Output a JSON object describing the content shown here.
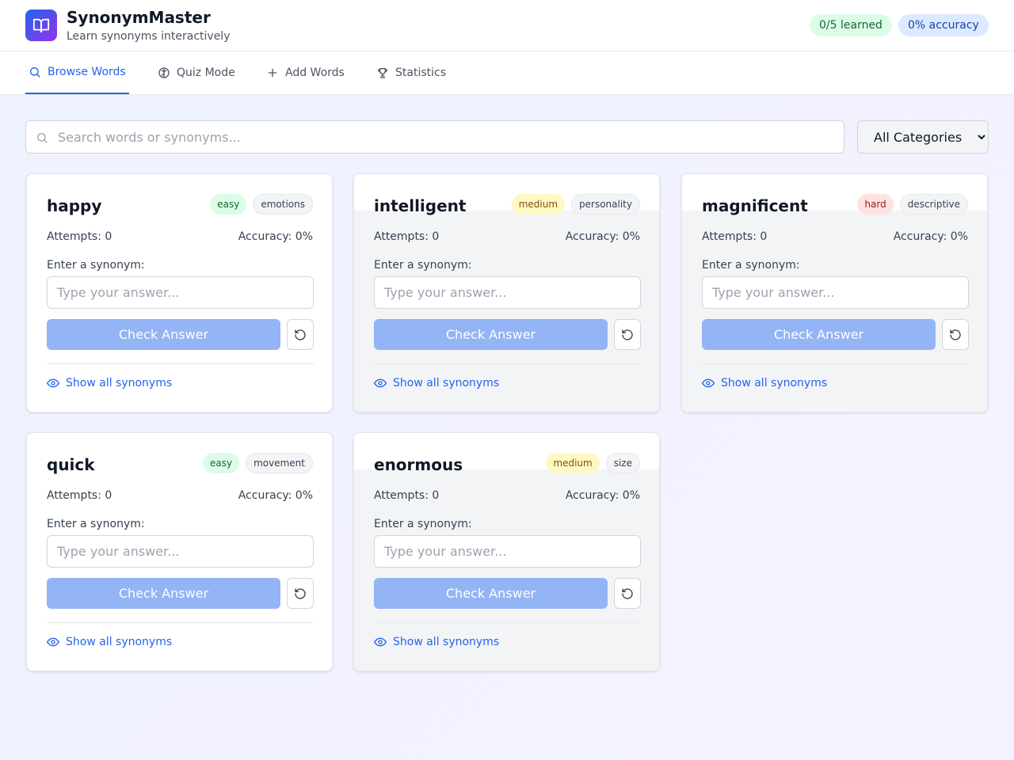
{
  "app": {
    "title": "SynonymMaster",
    "subtitle": "Learn synonyms interactively",
    "logo_icon": "book-open-icon"
  },
  "stats": {
    "learned": "0/5 learned",
    "accuracy": "0% accuracy"
  },
  "nav": {
    "tabs": [
      {
        "label": "Browse Words",
        "icon": "search-icon",
        "active": true
      },
      {
        "label": "Quiz Mode",
        "icon": "brain-icon",
        "active": false
      },
      {
        "label": "Add Words",
        "icon": "plus-icon",
        "active": false
      },
      {
        "label": "Statistics",
        "icon": "trophy-icon",
        "active": false
      }
    ]
  },
  "search": {
    "placeholder": "Search words or synonyms..."
  },
  "filter": {
    "selected": "All Categories"
  },
  "colors": {
    "accent": "#2563eb",
    "button_disabled": "#93b4f5",
    "easy": "#dcfce7",
    "medium": "#fef9c3",
    "hard": "#fee2e2"
  },
  "card_labels": {
    "enter_label": "Enter a synonym:",
    "answer_placeholder": "Type your answer...",
    "check_label": "Check Answer",
    "show_label": "Show all synonyms"
  },
  "cards": [
    {
      "word": "happy",
      "difficulty": "easy",
      "category": "emotions",
      "attempts": "Attempts: 0",
      "accuracy": "Accuracy: 0%"
    },
    {
      "word": "intelligent",
      "difficulty": "medium",
      "category": "personality",
      "attempts": "Attempts: 0",
      "accuracy": "Accuracy: 0%"
    },
    {
      "word": "magnificent",
      "difficulty": "hard",
      "category": "descriptive",
      "attempts": "Attempts: 0",
      "accuracy": "Accuracy: 0%"
    },
    {
      "word": "quick",
      "difficulty": "easy",
      "category": "movement",
      "attempts": "Attempts: 0",
      "accuracy": "Accuracy: 0%"
    },
    {
      "word": "enormous",
      "difficulty": "medium",
      "category": "size",
      "attempts": "Attempts: 0",
      "accuracy": "Accuracy: 0%"
    }
  ]
}
